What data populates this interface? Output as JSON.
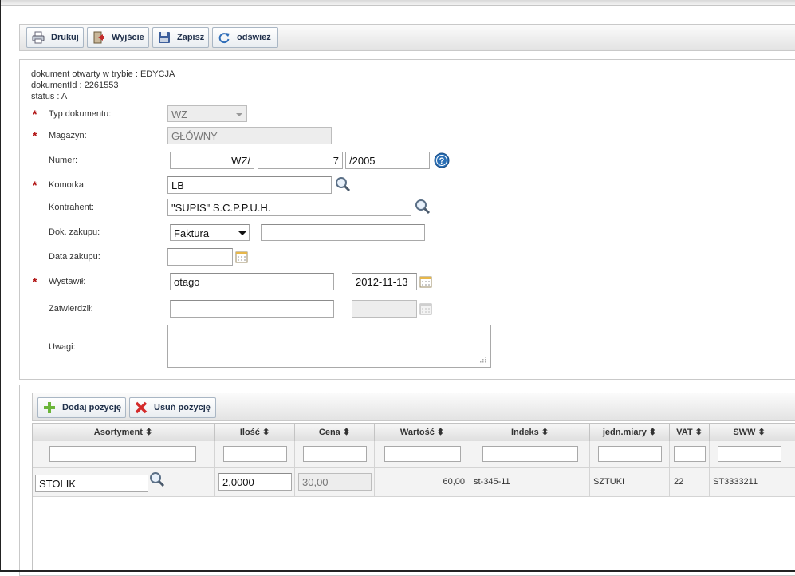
{
  "toolbar": {
    "print_label": "Drukuj",
    "exit_label": "Wyjście",
    "save_label": "Zapisz",
    "refresh_label": "odśwież"
  },
  "info": {
    "mode": "dokument otwarty w trybie : EDYCJA",
    "doc_id": "dokumentId : 2261553",
    "status": "status : A"
  },
  "form": {
    "doc_type_label": "Typ dokumentu:",
    "doc_type_value": "WZ",
    "warehouse_label": "Magazyn:",
    "warehouse_value": "GŁÓWNY",
    "number_label": "Numer:",
    "number_prefix": "WZ/",
    "number_value": "7",
    "number_suffix": "/2005",
    "cell_label": "Komorka:",
    "cell_value": "LB",
    "contractor_label": "Kontrahent:",
    "contractor_value": "\"SUPIS\" S.C.P.P.U.H.",
    "purchase_doc_label": "Dok. zakupu:",
    "purchase_doc_type": "Faktura",
    "purchase_doc_number": "",
    "purchase_date_label": "Data zakupu:",
    "purchase_date_value": "",
    "issued_by_label": "Wystawił:",
    "issued_by_value": "otago",
    "issued_date_value": "2012-11-13",
    "approved_by_label": "Zatwierdził:",
    "approved_by_value": "",
    "approved_date_value": "",
    "notes_label": "Uwagi:",
    "notes_value": ""
  },
  "positions_toolbar": {
    "add_label": "Dodaj pozycję",
    "remove_label": "Usuń pozycję"
  },
  "grid": {
    "columns": [
      "Asortyment ⬍",
      "Ilość ⬍",
      "Cena ⬍",
      "Wartość ⬍",
      "Indeks ⬍",
      "jedn.miary ⬍",
      "VAT ⬍",
      "SWW ⬍"
    ],
    "rows": [
      {
        "asortyment": "STOLIK",
        "ilosc": "2,0000",
        "cena": "30,00",
        "wartosc": "60,00",
        "indeks": "st-345-11",
        "jm": "SZTUKI",
        "vat": "22",
        "sww": "ST3333211"
      }
    ]
  },
  "colors": {
    "required_star": "#b01010",
    "toolbar_text": "#1f2f4a",
    "help_icon": "#2a6fb5"
  }
}
